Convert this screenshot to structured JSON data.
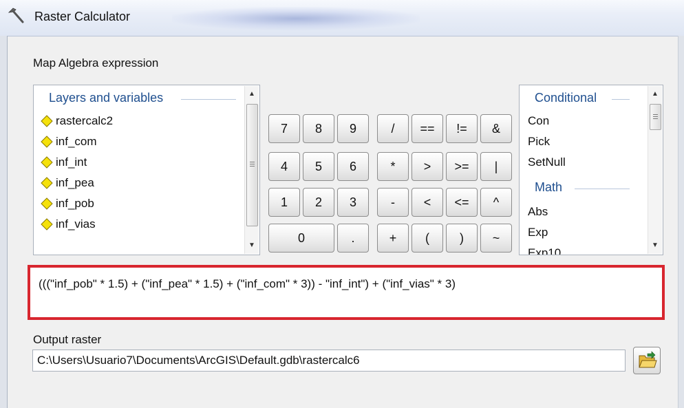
{
  "window": {
    "title": "Raster Calculator"
  },
  "labels": {
    "map_algebra": "Map Algebra expression",
    "output_raster": "Output raster"
  },
  "layers_panel": {
    "header": "Layers and variables",
    "items": [
      "rastercalc2",
      "inf_com",
      "inf_int",
      "inf_pea",
      "inf_pob",
      "inf_vias"
    ]
  },
  "keypad": {
    "row1": [
      "7",
      "8",
      "9",
      "/",
      "==",
      "!=",
      "&"
    ],
    "row2": [
      "4",
      "5",
      "6",
      "*",
      ">",
      ">=",
      "|"
    ],
    "row3": [
      "1",
      "2",
      "3",
      "-",
      "<",
      "<=",
      "^"
    ],
    "row4": [
      "0",
      ".",
      "+",
      "(",
      ")",
      "~"
    ]
  },
  "functions_panel": {
    "header_conditional": "Conditional",
    "conditional_items": [
      "Con",
      "Pick",
      "SetNull"
    ],
    "header_math": "Math",
    "math_items": [
      "Abs",
      "Exp",
      "Exp10"
    ]
  },
  "expression": "(((\"inf_pob\" * 1.5) + (\"inf_pea\" * 1.5) + (\"inf_com\" * 3)) - \"inf_int\") + (\"inf_vias\" * 3)",
  "output": {
    "path": "C:\\Users\\Usuario7\\Documents\\ArcGIS\\Default.gdb\\rastercalc6"
  },
  "icons": {
    "title": "hammer-icon",
    "layer": "raster-layer-diamond-icon",
    "browse": "open-folder-icon"
  },
  "colors": {
    "highlight_border": "#d8262f",
    "group_header": "#1f4f8f",
    "layer_diamond": "#f5e10a"
  }
}
